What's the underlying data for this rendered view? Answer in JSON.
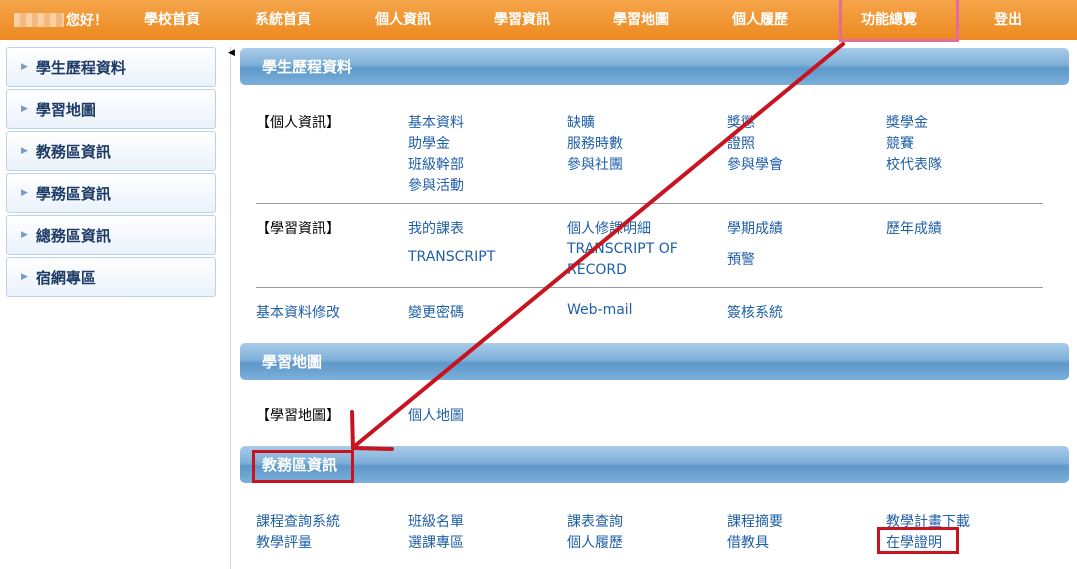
{
  "nav": {
    "greeting": "您好！",
    "items": [
      "學校首頁",
      "系統首頁",
      "個人資訊",
      "學習資訊",
      "學習地圖",
      "個人履歷",
      "功能總覽",
      "登出"
    ]
  },
  "sidebar": {
    "items": [
      "學生歷程資料",
      "學習地圖",
      "教務區資訊",
      "學務區資訊",
      "總務區資訊",
      "宿網專區"
    ]
  },
  "sections": {
    "student": {
      "title": "學生歷程資料",
      "personal_label": "【個人資訊】",
      "personal_links": [
        "基本資料",
        "缺曠",
        "獎懲",
        "獎學金",
        "助學金",
        "服務時數",
        "證照",
        "競賽",
        "班級幹部",
        "參與社團",
        "參與學會",
        "校代表隊",
        "參與活動"
      ],
      "study_label": "【學習資訊】",
      "study_links": [
        "我的課表",
        "個人修課明細",
        "學期成績",
        "歷年成績",
        "TRANSCRIPT",
        "TRANSCRIPT OF RECORD",
        "預警"
      ],
      "misc_links": [
        "基本資料修改",
        "變更密碼",
        "Web-mail",
        "簽核系統"
      ]
    },
    "map": {
      "title": "學習地圖",
      "label": "【學習地圖】",
      "links": [
        "個人地圖"
      ]
    },
    "academic": {
      "title": "教務區資訊",
      "links": [
        "課程查詢系統",
        "班級名單",
        "課表查詢",
        "課程摘要",
        "教學計畫下載",
        "教學評量",
        "選課專區",
        "個人履歷",
        "借教具",
        "在學證明"
      ]
    }
  },
  "colors": {
    "nav_bg": "#ec8a1f",
    "header_blue": "#6fa6d6",
    "link_blue": "#1f5fa8",
    "annotation_red": "#c8141e",
    "annotation_pink": "#e56b9a"
  }
}
